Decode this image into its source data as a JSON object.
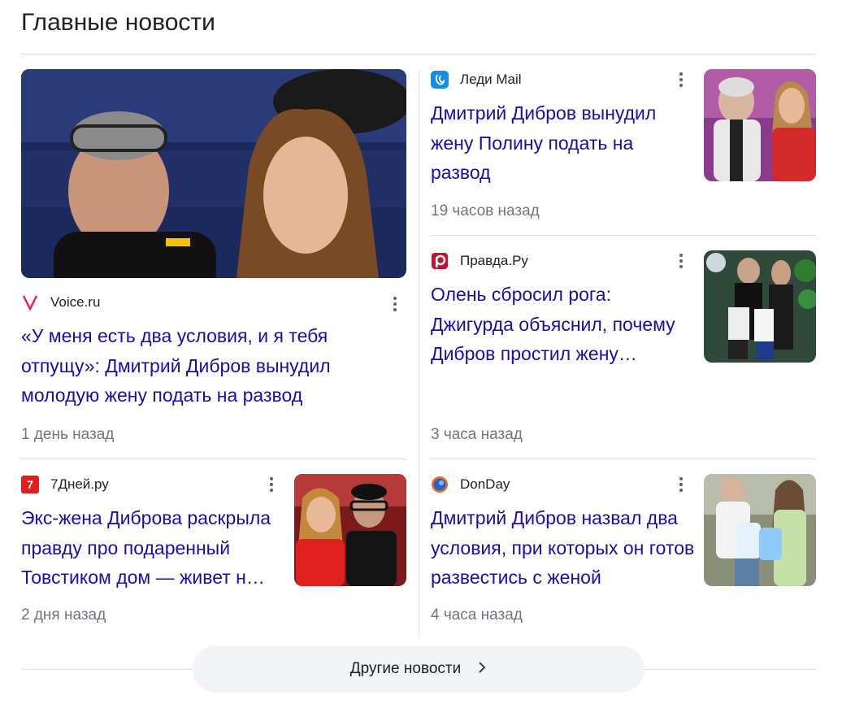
{
  "section": {
    "title": "Главные новости"
  },
  "articles": [
    {
      "source": "Voice.ru",
      "title": "«У меня есть два условия, и я тебя отпущу»: Дмитрий Дибров вынудил молодую жену подать на развод",
      "time": "1 день назад",
      "icon": "voice-logo-icon",
      "color": "#e91e63"
    },
    {
      "source": "Леди Mail",
      "title": "Дмитрий Дибров вынудил жену Полину подать на развод",
      "time": "19 часов назад",
      "icon": "ledi-mail-logo-icon",
      "color": "#168de2"
    },
    {
      "source": "Правда.Ру",
      "title": "Олень сбросил рога: Джигурда объяснил, почему Дибров простил жену…",
      "time": "3 часа назад",
      "icon": "pravda-logo-icon",
      "color": "#c4122e"
    },
    {
      "source": "7Дней.ру",
      "title": "Экс-жена Диброва раскрыла правду про подаренный Товстиком дом — живет н…",
      "time": "2 дня назад",
      "icon": "7days-logo-icon",
      "color": "#e11d1d",
      "logo_text": "7"
    },
    {
      "source": "DonDay",
      "title": "Дмитрий Дибров назвал два условия, при которых он готов развестись с женой",
      "time": "4 часа назад",
      "icon": "donday-logo-icon",
      "color": "#2a63c7"
    }
  ],
  "more_button": {
    "label": "Другие новости",
    "icon": "chevron-right-icon"
  }
}
